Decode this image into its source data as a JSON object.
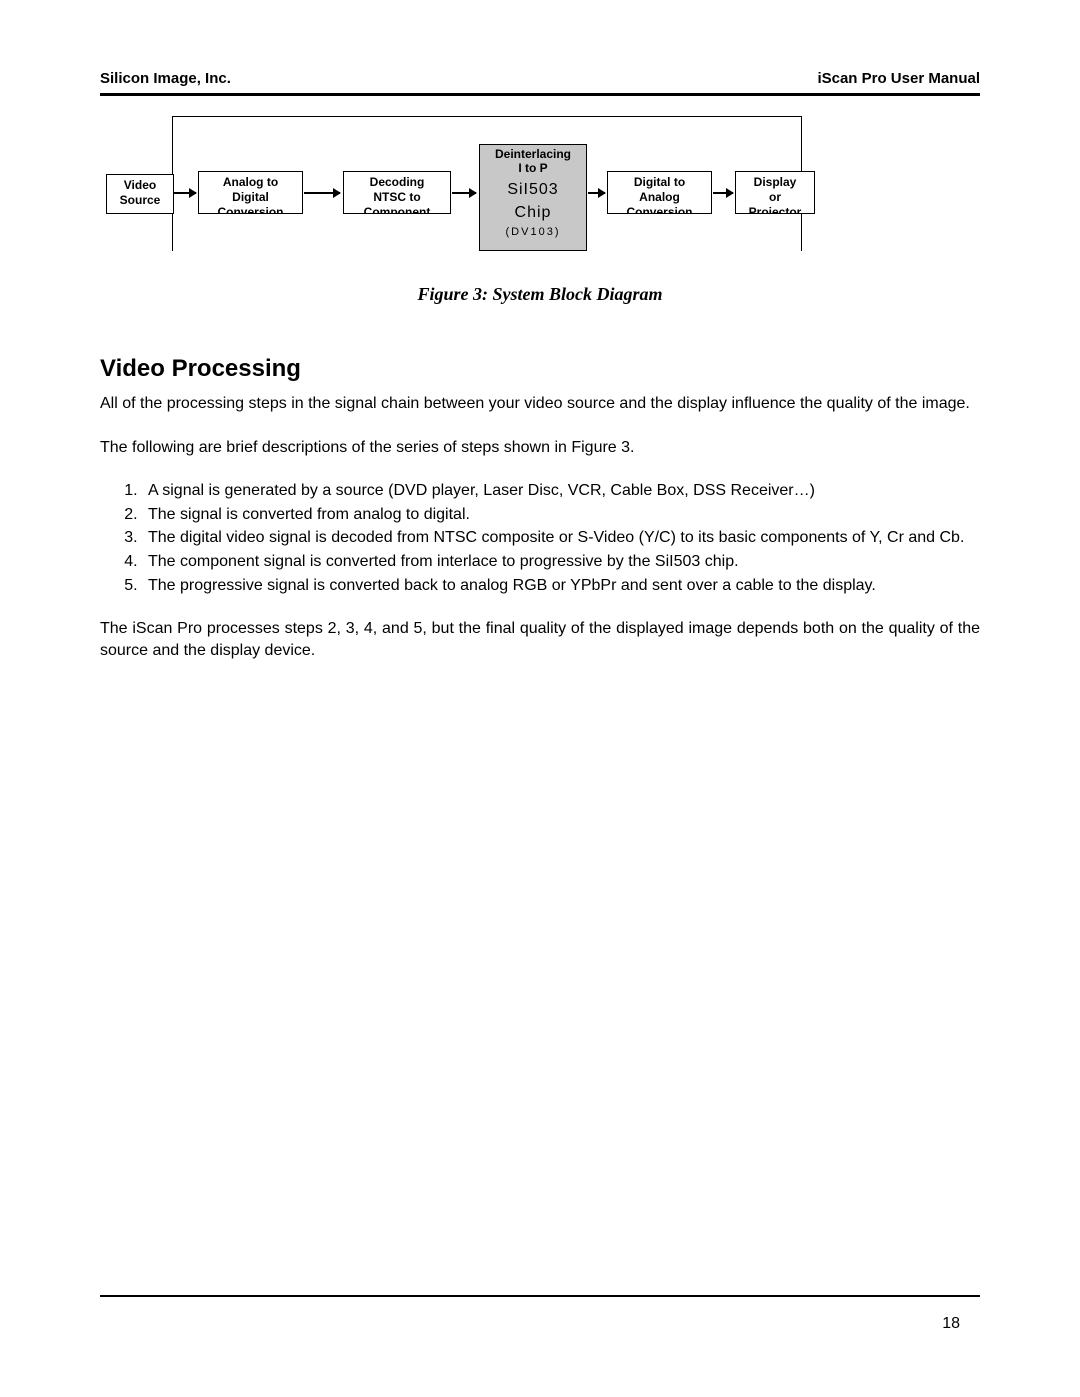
{
  "header": {
    "left": "Silicon Image, Inc.",
    "right": "iScan Pro User Manual"
  },
  "diagram": {
    "blocks": {
      "source": {
        "l1": "Video",
        "l2": "Source"
      },
      "adc": {
        "l1": "Analog to",
        "l2": "Digital",
        "l3": "Conversion"
      },
      "decode": {
        "l1": "Decoding",
        "l2": "NTSC to",
        "l3": "Component"
      },
      "chip": {
        "top1": "Deinterlacing",
        "top2": "I to P",
        "name1": "SiI503",
        "name2": "Chip",
        "sub": "(DV103)"
      },
      "dac": {
        "l1": "Digital to",
        "l2": "Analog",
        "l3": "Conversion"
      },
      "display": {
        "l1": "Display",
        "l2": "or",
        "l3": "Projector"
      }
    },
    "caption": "Figure 3: System Block Diagram"
  },
  "section": {
    "title": "Video Processing",
    "p1": "All of the processing steps in the signal chain between your video source and the display influence the quality of the image.",
    "p2": "The following are brief descriptions of the series of steps shown in Figure 3.",
    "steps": [
      "A signal is generated by a source (DVD player, Laser Disc, VCR, Cable Box, DSS Receiver…)",
      "The signal is converted from analog to digital.",
      "The digital video signal is decoded from NTSC composite or S-Video (Y/C) to its basic components of Y, Cr and Cb.",
      "The component signal is converted from interlace to progressive by the SiI503 chip.",
      "The progressive signal is converted back to analog RGB or YPbPr and sent over a cable to the display."
    ],
    "p3": "The iScan Pro processes steps 2, 3, 4, and 5, but the final quality of the displayed image depends both on the quality of the source and the display device."
  },
  "page_number": "18"
}
